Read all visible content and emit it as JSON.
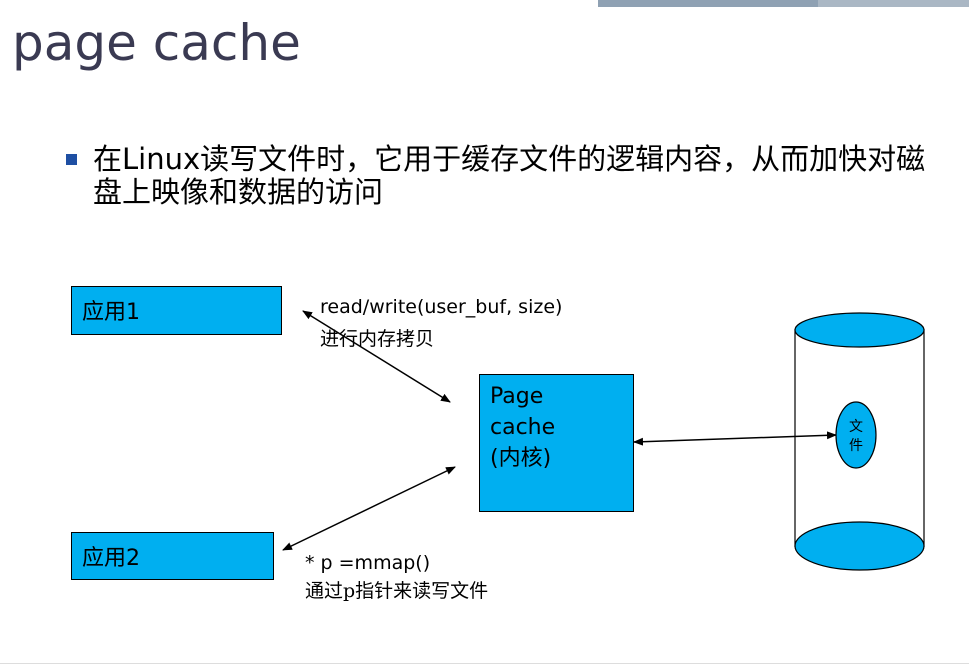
{
  "slide": {
    "title": "page cache",
    "bullet": "在Linux读写文件时，它用于缓存文件的逻辑内容，从而加快对磁盘上映像和数据的访问"
  },
  "diagram": {
    "app1_label": "应用1",
    "app2_label": "应用2",
    "page_cache_lines": [
      "Page",
      "cache",
      "(内核)"
    ],
    "read_write_label": "read/write(user_buf, size)",
    "read_write_sub": "进行内存拷贝",
    "mmap_label": "* p =mmap()",
    "mmap_sub": "通过p指针来读写文件",
    "file_label_lines": [
      "文",
      "件"
    ],
    "colors": {
      "box_fill": "#00aff0",
      "cylinder_cap": "#00aff0",
      "bullet": "#1e4fa3",
      "title": "#3a3a52"
    }
  }
}
